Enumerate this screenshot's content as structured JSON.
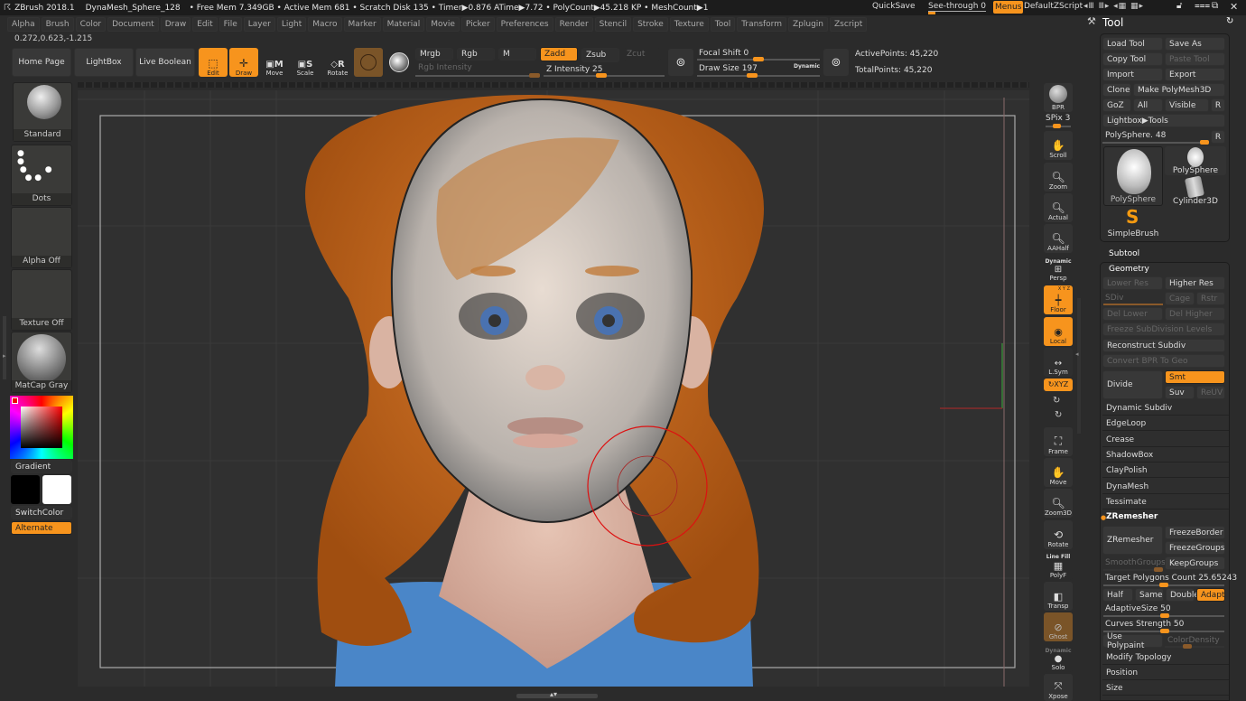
{
  "titlebar": {
    "app": "ZBrush 2018.1",
    "doc": "DynaMesh_Sphere_128",
    "stats": "• Free Mem 7.349GB • Active Mem 681 • Scratch Disk 135 •  Timer▶0.876 ATime▶7.72 • PolyCount▶45.218 KP  • MeshCount▶1",
    "quicksave": "QuickSave",
    "seethrough": "See-through  0",
    "menus": "Menus",
    "script": "DefaultZScript"
  },
  "menubar": [
    "Alpha",
    "Brush",
    "Color",
    "Document",
    "Draw",
    "Edit",
    "File",
    "Layer",
    "Light",
    "Macro",
    "Marker",
    "Material",
    "Movie",
    "Picker",
    "Preferences",
    "Render",
    "Stencil",
    "Stroke",
    "Texture",
    "Tool",
    "Transform",
    "Zplugin",
    "Zscript"
  ],
  "coords": "0.272,0.623,-1.215",
  "toolbar": {
    "home": "Home Page",
    "lightbox": "LightBox",
    "live_boolean": "Live Boolean",
    "edit": "Edit",
    "draw": "Draw",
    "move": "Move",
    "scale": "Scale",
    "rotate": "Rotate",
    "mrgb": "Mrgb",
    "rgb": "Rgb",
    "m": "M",
    "zadd": "Zadd",
    "zsub": "Zsub",
    "zcut": "Zcut",
    "rgb_intensity": "Rgb Intensity",
    "z_intensity": "Z Intensity 25",
    "z_intensity_value": 25,
    "focal_shift": "Focal Shift 0",
    "focal_shift_value": 0,
    "draw_size": "Draw Size 197",
    "draw_size_value": 197,
    "dynamic": "Dynamic",
    "active_points": "ActivePoints: 45,220",
    "total_points": "TotalPoints: 45,220"
  },
  "left_shelf": {
    "brush": "Standard",
    "stroke": "Dots",
    "alpha": "Alpha Off",
    "texture": "Texture Off",
    "material": "MatCap Gray",
    "gradient": "Gradient",
    "switch_color": "SwitchColor",
    "alternate": "Alternate",
    "main_color": "#000000",
    "secondary_color": "#ffffff"
  },
  "right_shelf": {
    "bpr": "BPR",
    "spix": "SPix 3",
    "scroll": "Scroll",
    "zoom": "Zoom",
    "actual": "Actual",
    "aahalf": "AAHalf",
    "dynamic": "Dynamic",
    "persp": "Persp",
    "xyz_small": "X Y Z",
    "floor": "Floor",
    "local": "Local",
    "lsym": "L.Sym",
    "xyz": "XYZ",
    "frame": "Frame",
    "move": "Move",
    "zoom3d": "Zoom3D",
    "rotate": "Rotate",
    "linefill": "Line Fill",
    "polyf": "PolyF",
    "transp": "Transp",
    "ghost": "Ghost",
    "solo_dynamic": "Dynamic",
    "solo": "Solo",
    "xpose": "Xpose"
  },
  "tool_panel": {
    "title": "Tool",
    "load_tool": "Load Tool",
    "save_as": "Save As",
    "copy_tool": "Copy Tool",
    "paste_tool": "Paste Tool",
    "import": "Import",
    "export": "Export",
    "clone": "Clone",
    "make_polymesh": "Make PolyMesh3D",
    "goz": "GoZ",
    "all": "All",
    "visible": "Visible",
    "r": "R",
    "lightbox_tools": "Lightbox▶Tools",
    "polysphere_slider": "PolySphere. 48",
    "thumbs": [
      "PolySphere",
      "PolySphere",
      "Cylinder3D",
      "SimpleBrush"
    ],
    "subtool": "Subtool",
    "geometry": "Geometry",
    "lower_res": "Lower Res",
    "higher_res": "Higher Res",
    "sdiv": "SDiv",
    "cage": "Cage",
    "rstr": "Rstr",
    "del_lower": "Del Lower",
    "del_higher": "Del Higher",
    "freeze_subdiv": "Freeze SubDivision Levels",
    "reconstruct_subdiv": "Reconstruct Subdiv",
    "convert_bpr": "Convert BPR To Geo",
    "divide": "Divide",
    "smt": "Smt",
    "suv": "Suv",
    "reuv": "ReUV",
    "sections": [
      "Dynamic Subdiv",
      "EdgeLoop",
      "Crease",
      "ShadowBox",
      "ClayPolish",
      "DynaMesh",
      "Tessimate"
    ],
    "zremesher_header": "ZRemesher",
    "zremesher_btn": "ZRemesher",
    "freeze_border": "FreezeBorder",
    "freeze_groups": "FreezeGroups",
    "smooth_groups": "SmoothGroups",
    "keep_groups": "KeepGroups",
    "target_polygons": "Target Polygons Count 25.65243",
    "half": "Half",
    "same": "Same",
    "double": "Double",
    "adapt": "Adapt",
    "adaptive_size": "AdaptiveSize 50",
    "curves_strength": "Curves Strength 50",
    "use_polypaint": "Use Polypaint",
    "color_density": "ColorDensity",
    "modify_topology": "Modify Topology",
    "position": "Position",
    "size": "Size"
  },
  "colors": {
    "accent": "#f7941d",
    "bg": "#2b2b2b"
  }
}
